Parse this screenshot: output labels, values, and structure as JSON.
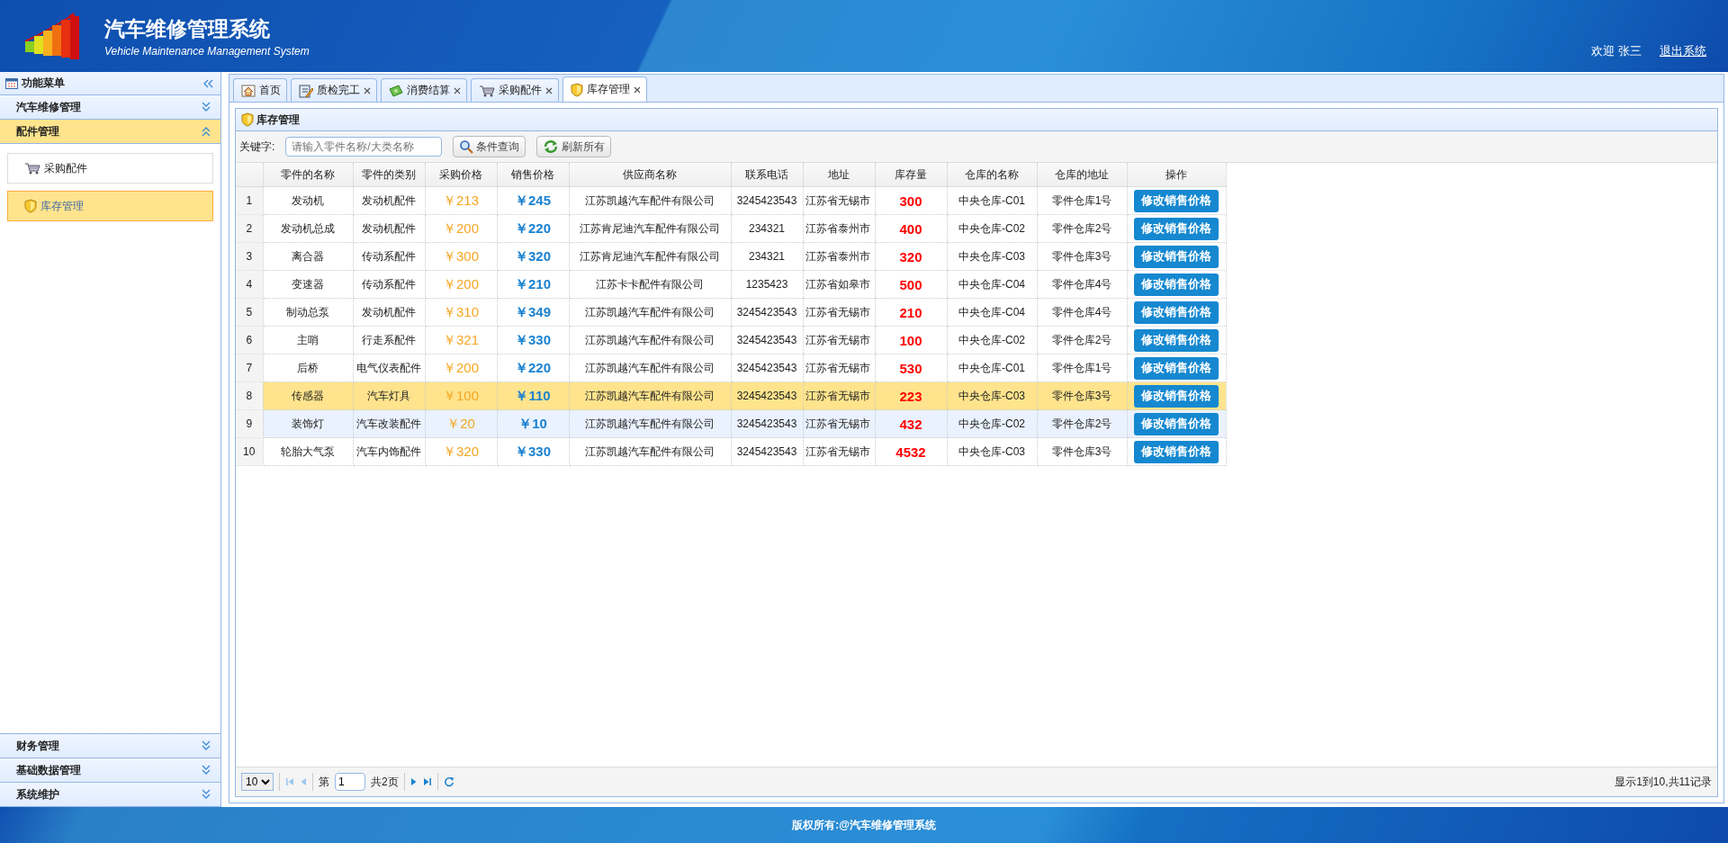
{
  "header": {
    "title": "汽车维修管理系统",
    "subtitle": "Vehicle Maintenance Management System",
    "welcome": "欢迎 张三",
    "logout": "退出系统"
  },
  "sidebar": {
    "title": "功能菜单",
    "sections": [
      {
        "label": "汽车维修管理",
        "expanded": false
      },
      {
        "label": "配件管理",
        "expanded": true,
        "items": [
          {
            "label": "采购配件",
            "kind": "cart",
            "selected": false
          },
          {
            "label": "库存管理",
            "kind": "shield",
            "selected": true
          }
        ]
      },
      {
        "label": "财务管理",
        "expanded": false
      },
      {
        "label": "基础数据管理",
        "expanded": false
      },
      {
        "label": "系统维护",
        "expanded": false
      }
    ]
  },
  "tabs": [
    {
      "label": "首页",
      "kind": "home",
      "closable": false,
      "selected": false
    },
    {
      "label": "质检完工",
      "kind": "edit",
      "closable": true,
      "selected": false
    },
    {
      "label": "消费结算",
      "kind": "money",
      "closable": true,
      "selected": false
    },
    {
      "label": "采购配件",
      "kind": "cart",
      "closable": true,
      "selected": false
    },
    {
      "label": "库存管理",
      "kind": "shield",
      "closable": true,
      "selected": true
    }
  ],
  "panel": {
    "title": "库存管理",
    "keyword_label": "关键字:",
    "search": {
      "placeholder": "请输入零件名称/大类名称"
    },
    "buttons": [
      {
        "label": "条件查询",
        "kind": "search"
      },
      {
        "label": "刷新所有",
        "kind": "refresh"
      }
    ]
  },
  "table": {
    "columns": [
      {
        "label": "零件的名称",
        "kind": "text"
      },
      {
        "label": "零件的类别",
        "kind": "text"
      },
      {
        "label": "采购价格",
        "kind": "cost"
      },
      {
        "label": "销售价格",
        "kind": "price"
      },
      {
        "label": "供应商名称",
        "kind": "wide"
      },
      {
        "label": "联系电话",
        "kind": "text"
      },
      {
        "label": "地址",
        "kind": "left"
      },
      {
        "label": "库存量",
        "kind": "stock"
      },
      {
        "label": "仓库的名称",
        "kind": "name"
      },
      {
        "label": "仓库的地址",
        "kind": "name"
      },
      {
        "label": "操作",
        "kind": "action"
      }
    ],
    "rows": [
      {
        "number": "1",
        "selected": false,
        "hovered": false,
        "cells": [
          "发动机",
          "发动机配件",
          "￥213",
          "￥245",
          "江苏凯越汽车配件有限公司",
          "3245423543",
          "江苏省无锡市",
          "300",
          "中央仓库-C01",
          "零件仓库1号",
          "修改销售价格"
        ]
      },
      {
        "number": "2",
        "selected": false,
        "hovered": false,
        "cells": [
          "发动机总成",
          "发动机配件",
          "￥200",
          "￥220",
          "江苏肯尼迪汽车配件有限公司",
          "234321",
          "江苏省泰州市",
          "400",
          "中央仓库-C02",
          "零件仓库2号",
          "修改销售价格"
        ]
      },
      {
        "number": "3",
        "selected": false,
        "hovered": false,
        "cells": [
          "离合器",
          "传动系配件",
          "￥300",
          "￥320",
          "江苏肯尼迪汽车配件有限公司",
          "234321",
          "江苏省泰州市",
          "320",
          "中央仓库-C03",
          "零件仓库3号",
          "修改销售价格"
        ]
      },
      {
        "number": "4",
        "selected": false,
        "hovered": false,
        "cells": [
          "变速器",
          "传动系配件",
          "￥200",
          "￥210",
          "江苏卡卡配件有限公司",
          "1235423",
          "江苏省如皋市",
          "500",
          "中央仓库-C04",
          "零件仓库4号",
          "修改销售价格"
        ]
      },
      {
        "number": "5",
        "selected": false,
        "hovered": false,
        "cells": [
          "制动总泵",
          "发动机配件",
          "￥310",
          "￥349",
          "江苏凯越汽车配件有限公司",
          "3245423543",
          "江苏省无锡市",
          "210",
          "中央仓库-C04",
          "零件仓库4号",
          "修改销售价格"
        ]
      },
      {
        "number": "6",
        "selected": false,
        "hovered": false,
        "cells": [
          "主哨",
          "行走系配件",
          "￥321",
          "￥330",
          "江苏凯越汽车配件有限公司",
          "3245423543",
          "江苏省无锡市",
          "100",
          "中央仓库-C02",
          "零件仓库2号",
          "修改销售价格"
        ]
      },
      {
        "number": "7",
        "selected": false,
        "hovered": false,
        "cells": [
          "后桥",
          "电气仪表配件",
          "￥200",
          "￥220",
          "江苏凯越汽车配件有限公司",
          "3245423543",
          "江苏省无锡市",
          "530",
          "中央仓库-C01",
          "零件仓库1号",
          "修改销售价格"
        ]
      },
      {
        "number": "8",
        "selected": true,
        "hovered": false,
        "cells": [
          "传感器",
          "汽车灯具",
          "￥100",
          "￥110",
          "江苏凯越汽车配件有限公司",
          "3245423543",
          "江苏省无锡市",
          "223",
          "中央仓库-C03",
          "零件仓库3号",
          "修改销售价格"
        ]
      },
      {
        "number": "9",
        "selected": false,
        "hovered": true,
        "cells": [
          "装饰灯",
          "汽车改装配件",
          "￥20",
          "￥10",
          "江苏凯越汽车配件有限公司",
          "3245423543",
          "江苏省无锡市",
          "432",
          "中央仓库-C02",
          "零件仓库2号",
          "修改销售价格"
        ]
      },
      {
        "number": "10",
        "selected": false,
        "hovered": false,
        "cells": [
          "轮胎大气泵",
          "汽车内饰配件",
          "￥320",
          "￥330",
          "江苏凯越汽车配件有限公司",
          "3245423543",
          "江苏省无锡市",
          "4532",
          "中央仓库-C03",
          "零件仓库3号",
          "修改销售价格"
        ]
      }
    ]
  },
  "pager": {
    "page_size": "10",
    "page_label": "第",
    "page": "1",
    "total_pages": "共2页",
    "summary": "显示1到10,共11记录"
  },
  "footer": {
    "copyright": "版权所有:@汽车维修管理系统"
  }
}
